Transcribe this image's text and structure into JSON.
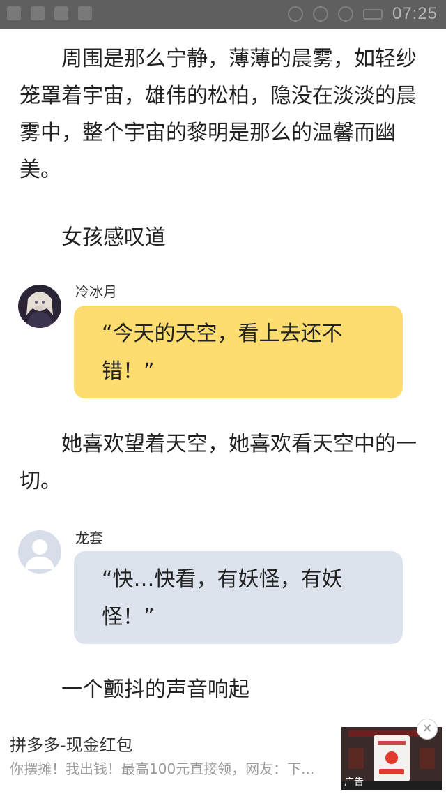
{
  "status_bar": {
    "time": "07:25"
  },
  "story": {
    "p1": "周围是那么宁静，薄薄的晨雾，如轻纱笼罩着宇宙，雄伟的松柏，隐没在淡淡的晨雾中，整个宇宙的黎明是那么的温馨而幽美。",
    "p2": "女孩感叹道",
    "msg1": {
      "speaker": "冷冰月",
      "text": "“今天的天空，看上去还不错！”"
    },
    "p3": "她喜欢望着天空，她喜欢看天空中的一切。",
    "msg2": {
      "speaker": "龙套",
      "text": "“快…快看，有妖怪，有妖怪！”"
    },
    "p4": "一个颤抖的声音响起"
  },
  "ad": {
    "title": "拼多多-现金红包",
    "description": "你摆摊！我出钱！最高100元直接领，网友：下...",
    "label": "广告",
    "close_symbol": "✕"
  }
}
